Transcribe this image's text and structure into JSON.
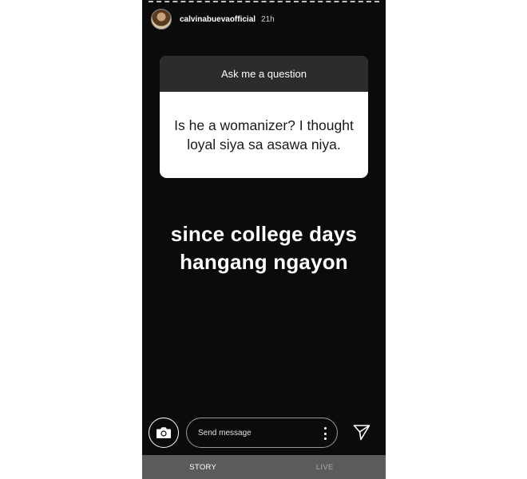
{
  "story": {
    "username": "calvinabuevaofficial",
    "time_ago": "21h"
  },
  "question_sticker": {
    "header": "Ask me a question",
    "question": "Is he a womanizer? I thought loyal siya sa asawa niya."
  },
  "answer_text": {
    "line1": "since college days",
    "line2": "hangang ngayon"
  },
  "reply_bar": {
    "placeholder": "Send message",
    "camera_icon": "camera-icon",
    "more_icon": "more-vertical-icon",
    "send_icon": "send-icon"
  },
  "tabs": [
    {
      "label": "STORY",
      "active": true
    },
    {
      "label": "LIVE",
      "active": false
    }
  ],
  "colors": {
    "background": "#0b0b0b",
    "card_header": "#2c2c2c",
    "tab_bar": "#5b5b5b"
  }
}
